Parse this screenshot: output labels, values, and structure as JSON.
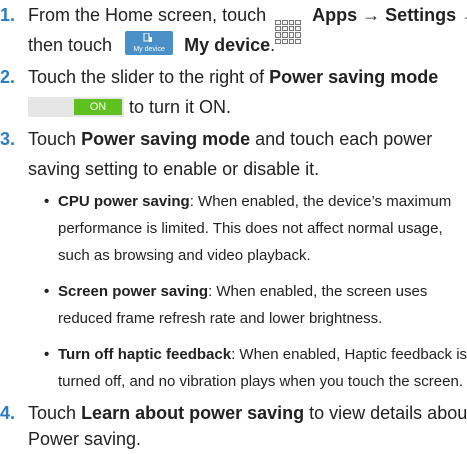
{
  "steps": [
    {
      "number": "1.",
      "line1": {
        "pre": "From the Home screen, touch",
        "apps_icon": "apps-grid-icon",
        "apps": "Apps",
        "arrow1": "→",
        "settings": "Settings",
        "arrow2": "→"
      },
      "line2": {
        "pre": "then touch",
        "mydevice_icon_caption": "My device",
        "mydevice": "My device",
        "post": "."
      }
    },
    {
      "number": "2.",
      "line1": {
        "pre": "Touch the slider to the right of",
        "bold": "Power saving mode"
      },
      "line2": {
        "toggle_label": "ON",
        "post": "to turn it ON."
      }
    },
    {
      "number": "3.",
      "line1": {
        "pre": "Touch",
        "bold": "Power saving mode",
        "post": "and touch each power"
      },
      "line2": "saving setting to enable or disable it.",
      "bullets": [
        {
          "bullet": "•",
          "title": "CPU power saving",
          "line1": ": When enabled, the device’s maximum",
          "line2": "performance is limited. This does not affect normal usage,",
          "line3": "such as browsing and video playback."
        },
        {
          "bullet": "•",
          "title": "Screen power saving",
          "line1": ": When enabled, the screen uses",
          "line2": "reduced frame refresh rate and lower brightness."
        },
        {
          "bullet": "•",
          "title": "Turn off haptic feedback",
          "line1": ": When enabled, Haptic feedback is",
          "line2": "turned off, and no vibration plays when you touch the screen."
        }
      ]
    },
    {
      "number": "4.",
      "line1": {
        "pre": "Touch",
        "bold": "Learn about power saving",
        "post": "to view details about"
      },
      "line2": "Power saving."
    }
  ],
  "colors": {
    "step_number": "#2a7bc8",
    "toggle_on": "#5fc11f",
    "mydevice_tile": "#4a90c8"
  }
}
